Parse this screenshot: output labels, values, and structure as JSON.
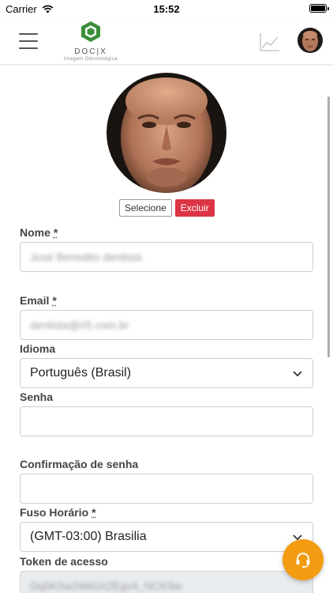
{
  "status_bar": {
    "carrier": "Carrier",
    "time": "15:52"
  },
  "header": {
    "logo_text": "DOC|X",
    "logo_subtitle": "Imagem Odontológica",
    "brand_color": "#3a8f3a"
  },
  "photo": {
    "select_label": "Selecione",
    "delete_label": "Excluir",
    "delete_color": "#dc3545"
  },
  "form": {
    "name": {
      "label": "Nome",
      "required": "*",
      "value": "José Benedito dentista"
    },
    "email": {
      "label": "Email",
      "required": "*",
      "value": "dentista@ri5.com.br"
    },
    "language": {
      "label": "Idioma",
      "value": "Português (Brasil)"
    },
    "password": {
      "label": "Senha",
      "value": ""
    },
    "password_confirm": {
      "label": "Confirmação de senha",
      "value": ""
    },
    "timezone": {
      "label": "Fuso Horário",
      "required": "*",
      "value": "(GMT-03:00) Brasilia"
    },
    "token": {
      "label": "Token de acesso",
      "value": "Dq0K5w248GXZEgv4_NCK9w"
    }
  },
  "support": {
    "icon": "headset-icon",
    "color": "#f39c12"
  }
}
